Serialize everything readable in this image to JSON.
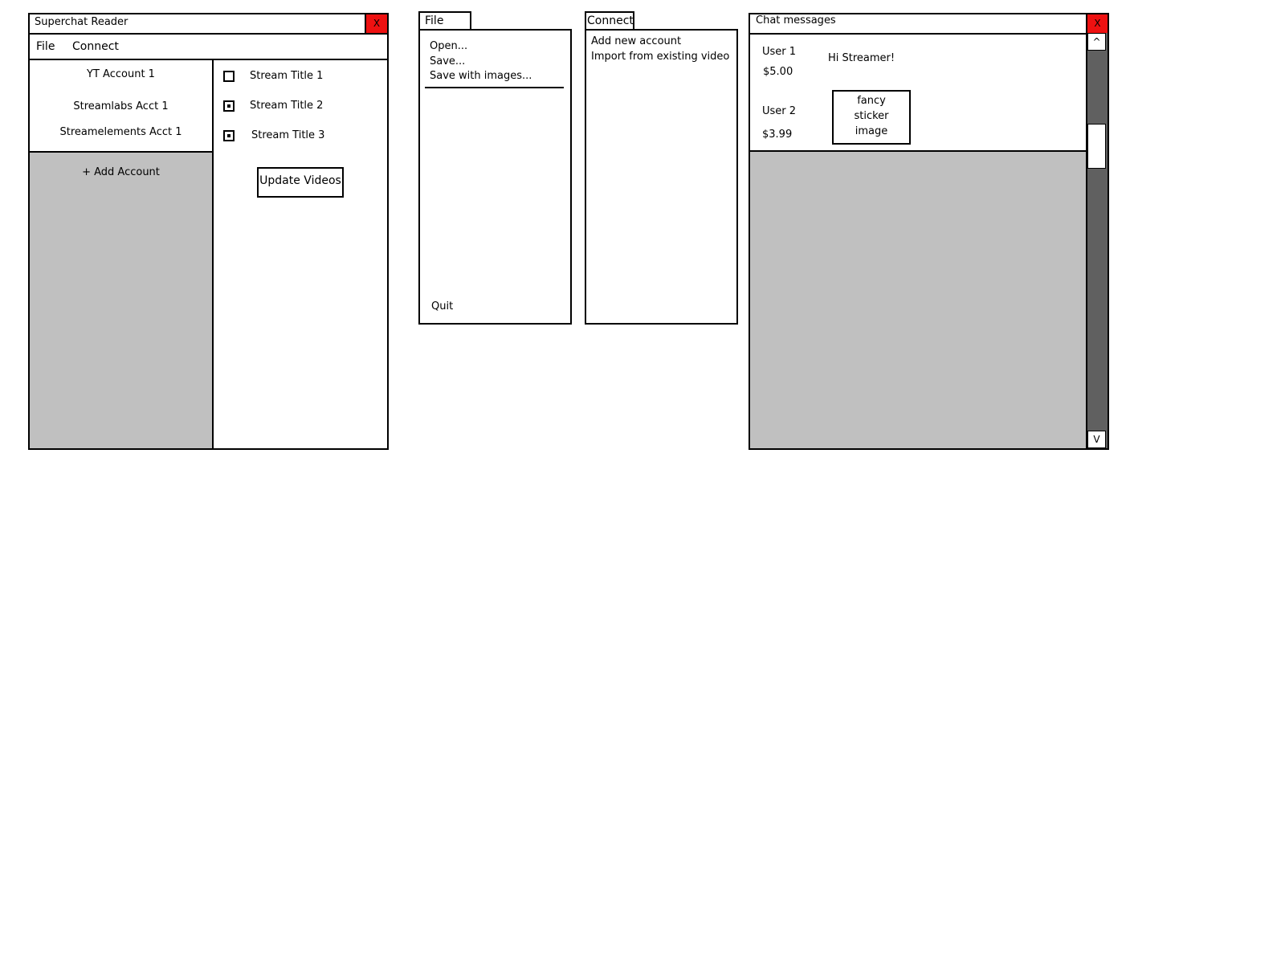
{
  "main_window": {
    "title": "Superchat Reader",
    "close_label": "X",
    "menu": [
      "File",
      "Connect"
    ],
    "accounts": [
      "YT Account 1",
      "Streamlabs Acct 1",
      "Streamelements Acct 1"
    ],
    "add_account_label": "+ Add Account",
    "streams": [
      {
        "title": "Stream Title 1",
        "checked": false
      },
      {
        "title": "Stream Title 2",
        "checked": true
      },
      {
        "title": "Stream Title 3",
        "checked": true
      }
    ],
    "update_button_label": "Update Videos"
  },
  "file_menu": {
    "tab_label": "File",
    "items": [
      "Open...",
      "Save...",
      "Save with images..."
    ],
    "quit_label": "Quit"
  },
  "connect_menu": {
    "tab_label": "Connect",
    "items": [
      "Add new account",
      "Import from existing video"
    ]
  },
  "chat_window": {
    "title": "Chat messages",
    "close_label": "X",
    "messages": [
      {
        "user": "User 1",
        "amount": "$5.00",
        "text": "Hi Streamer!"
      },
      {
        "user": "User 2",
        "amount": "$3.99",
        "sticker_lines": [
          "fancy",
          "sticker",
          "image"
        ]
      }
    ],
    "scroll_up_label": "^",
    "scroll_down_label": "V"
  },
  "colors": {
    "close_button": "#ee1111",
    "panel_gray": "#c0c0c0",
    "scrollbar_track": "#606060"
  }
}
